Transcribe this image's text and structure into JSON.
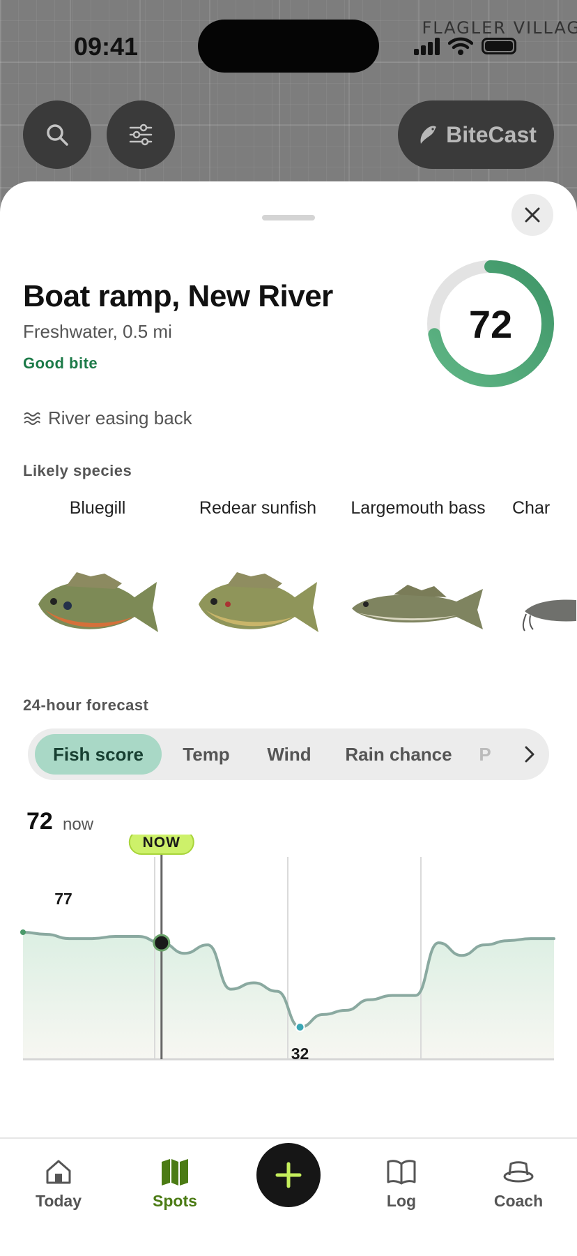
{
  "status": {
    "time": "09:41",
    "location_label": "FLAGLER VILLAG"
  },
  "map_controls": {
    "search_icon": "search-icon",
    "filter_icon": "sliders-icon",
    "bitecast_label": "BiteCast"
  },
  "spot": {
    "name": "Boat ramp, New River",
    "subtitle": "Freshwater, 0.5 mi",
    "bite_status": "Good bite",
    "score": "72",
    "score_fraction": 0.72,
    "condition": "River easing back"
  },
  "species": {
    "label": "Likely species",
    "items": [
      {
        "name": "Bluegill"
      },
      {
        "name": "Redear sunfish"
      },
      {
        "name": "Largemouth bass"
      },
      {
        "name": "Char"
      }
    ]
  },
  "forecast": {
    "label": "24-hour forecast",
    "tabs": [
      "Fish score",
      "Temp",
      "Wind",
      "Rain chance",
      "P"
    ],
    "active_tab": "Fish score",
    "now_value": "72",
    "now_word": "now",
    "now_badge": "NOW",
    "max_label": "77",
    "min_label": "32"
  },
  "chart_data": {
    "type": "area",
    "title": "",
    "xlabel": "",
    "ylabel": "",
    "series": [
      {
        "values": [
          77,
          76,
          74,
          74,
          75,
          75,
          72,
          67,
          71,
          50,
          53,
          49,
          32,
          38,
          40,
          45,
          47,
          47,
          72,
          66,
          71,
          73,
          74,
          74
        ]
      }
    ],
    "now_index": 6,
    "max_value": 77,
    "min_value": 32,
    "ylim": [
      0,
      100
    ],
    "grid": "vertical",
    "colors": {
      "high": "#4a9a6a",
      "mid": "#c98b2a",
      "low": "#3aa7b5"
    }
  },
  "tabbar": {
    "items": [
      {
        "label": "Today",
        "icon": "home-icon"
      },
      {
        "label": "Spots",
        "icon": "map-icon"
      },
      {
        "label": "Log",
        "icon": "book-icon"
      },
      {
        "label": "Coach",
        "icon": "hat-icon"
      }
    ],
    "active": "Spots",
    "fab_icon": "plus-icon"
  },
  "colors": {
    "accent": "#1c7a48",
    "badge": "#cdf16a",
    "tab_active": "#a9d8c6"
  }
}
